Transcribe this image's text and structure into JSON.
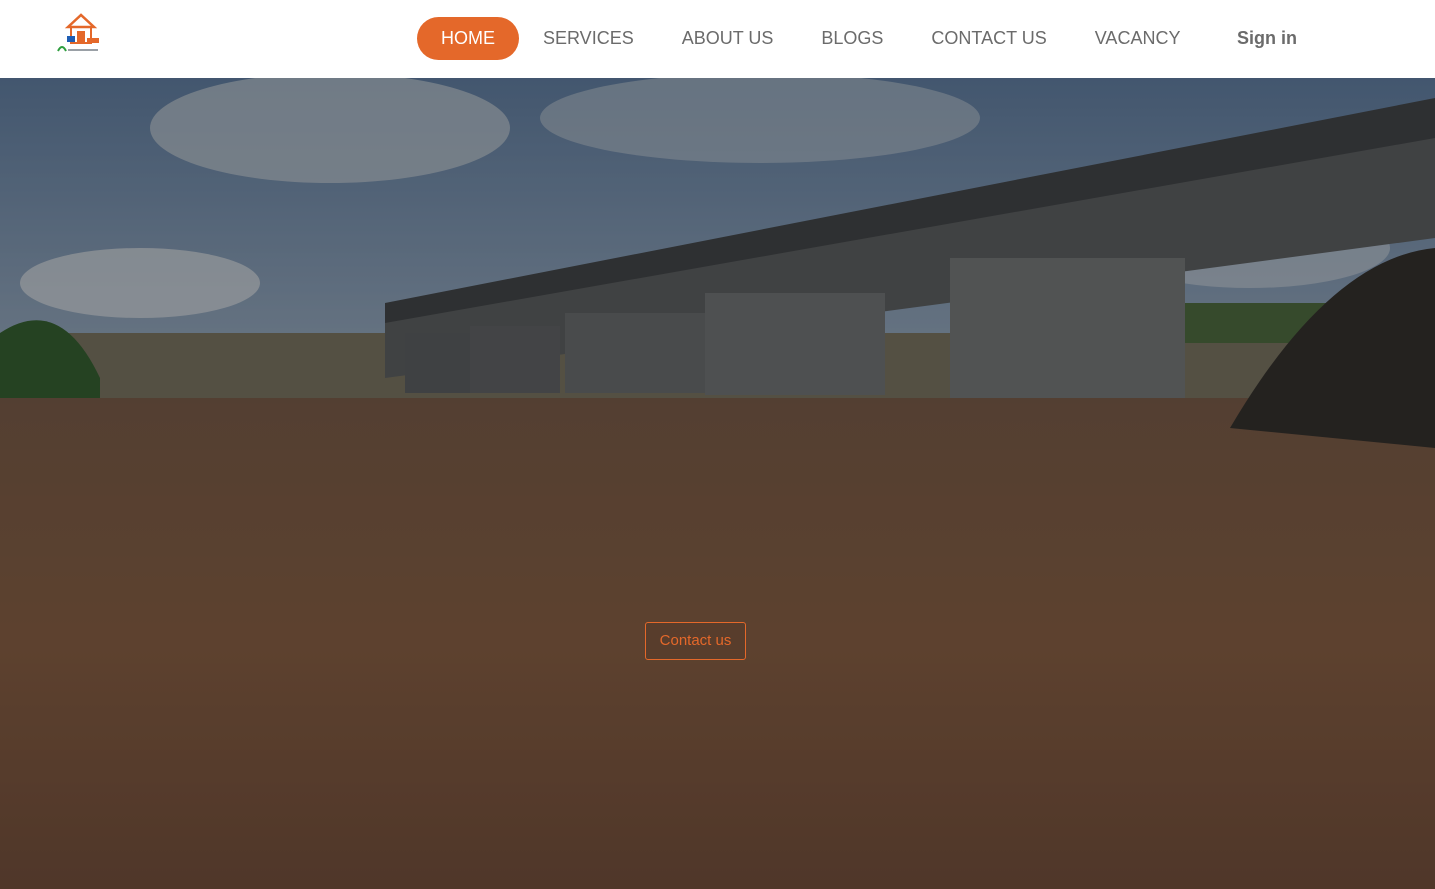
{
  "nav": {
    "items": [
      {
        "label": "HOME",
        "active": true
      },
      {
        "label": "SERVICES"
      },
      {
        "label": "ABOUT US"
      },
      {
        "label": "BLOGS"
      },
      {
        "label": "CONTACT US"
      },
      {
        "label": "VACANCY"
      }
    ],
    "signin_label": "Sign in"
  },
  "hero": {
    "cta_label": "Contact us",
    "image": "river-bridge-photo"
  },
  "colors": {
    "accent": "#e4682a",
    "nav_text": "#6b6b6b"
  },
  "logo": {
    "icon": "house-logo-icon"
  }
}
